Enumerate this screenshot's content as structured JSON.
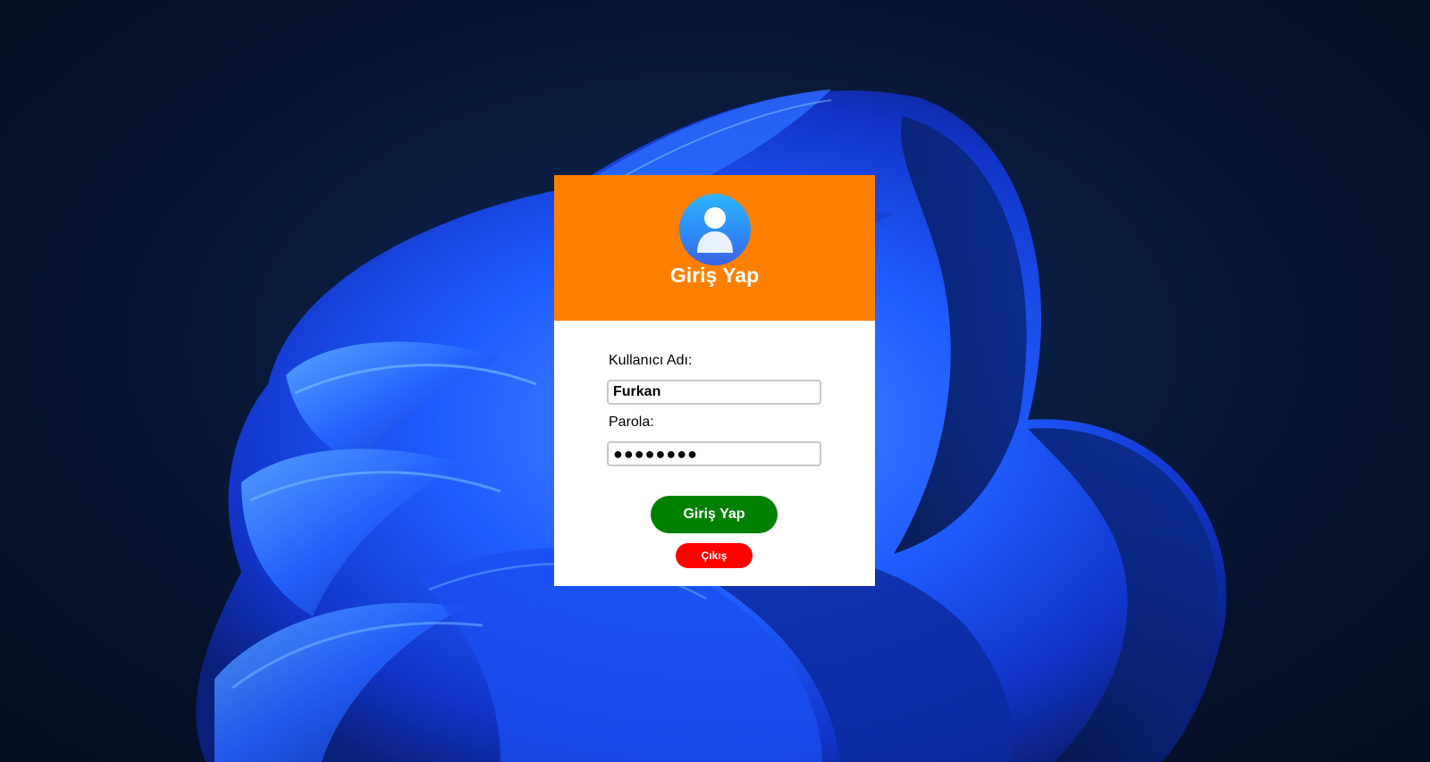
{
  "wallpaper": {
    "name": "windows-bloom",
    "background_color": "#071430",
    "accent_color": "#1e5bff"
  },
  "login": {
    "header_color": "#ff8000",
    "title": "Giriş Yap",
    "avatar_icon": "user-icon",
    "username": {
      "label": "Kullanıcı Adı:",
      "value": "Furkan"
    },
    "password": {
      "label": "Parola:",
      "value_masked": "●●●●●●●●"
    },
    "login_button": {
      "label": "Giriş Yap",
      "color": "#008000"
    },
    "exit_button": {
      "label": "Çıkış",
      "color": "#ff0000"
    }
  }
}
